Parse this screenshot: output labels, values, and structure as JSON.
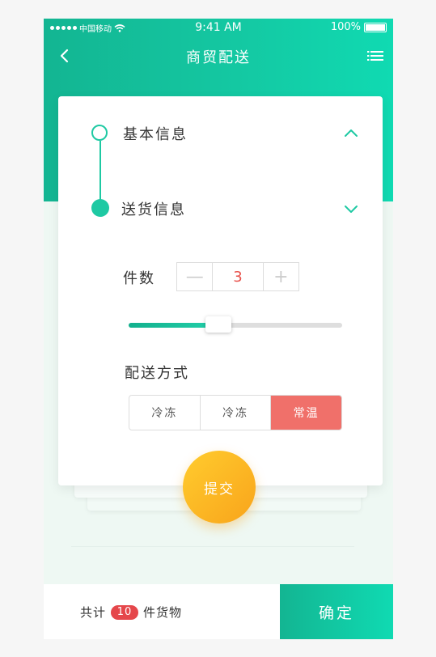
{
  "status_bar": {
    "carrier": "中国移动",
    "time": "9:41 AM",
    "battery": "100%"
  },
  "nav": {
    "title": "商贸配送"
  },
  "steps": [
    {
      "label": "基本信息",
      "state": "collapsed"
    },
    {
      "label": "送货信息",
      "state": "expanded"
    }
  ],
  "form": {
    "quantity_label": "件数",
    "quantity_value": "3",
    "minus": "—",
    "plus": "+",
    "slider_fraction": 0.42,
    "method_label": "配送方式",
    "options": [
      "冷冻",
      "冷冻",
      "常温"
    ],
    "selected_option_index": 2
  },
  "submit_label": "提交",
  "footer": {
    "prefix": "共计",
    "count": "10",
    "suffix": "件货物",
    "confirm_label": "确定"
  },
  "colors": {
    "accent": "#14c8a2",
    "danger": "#f0706a",
    "submit": "#fbb624"
  }
}
